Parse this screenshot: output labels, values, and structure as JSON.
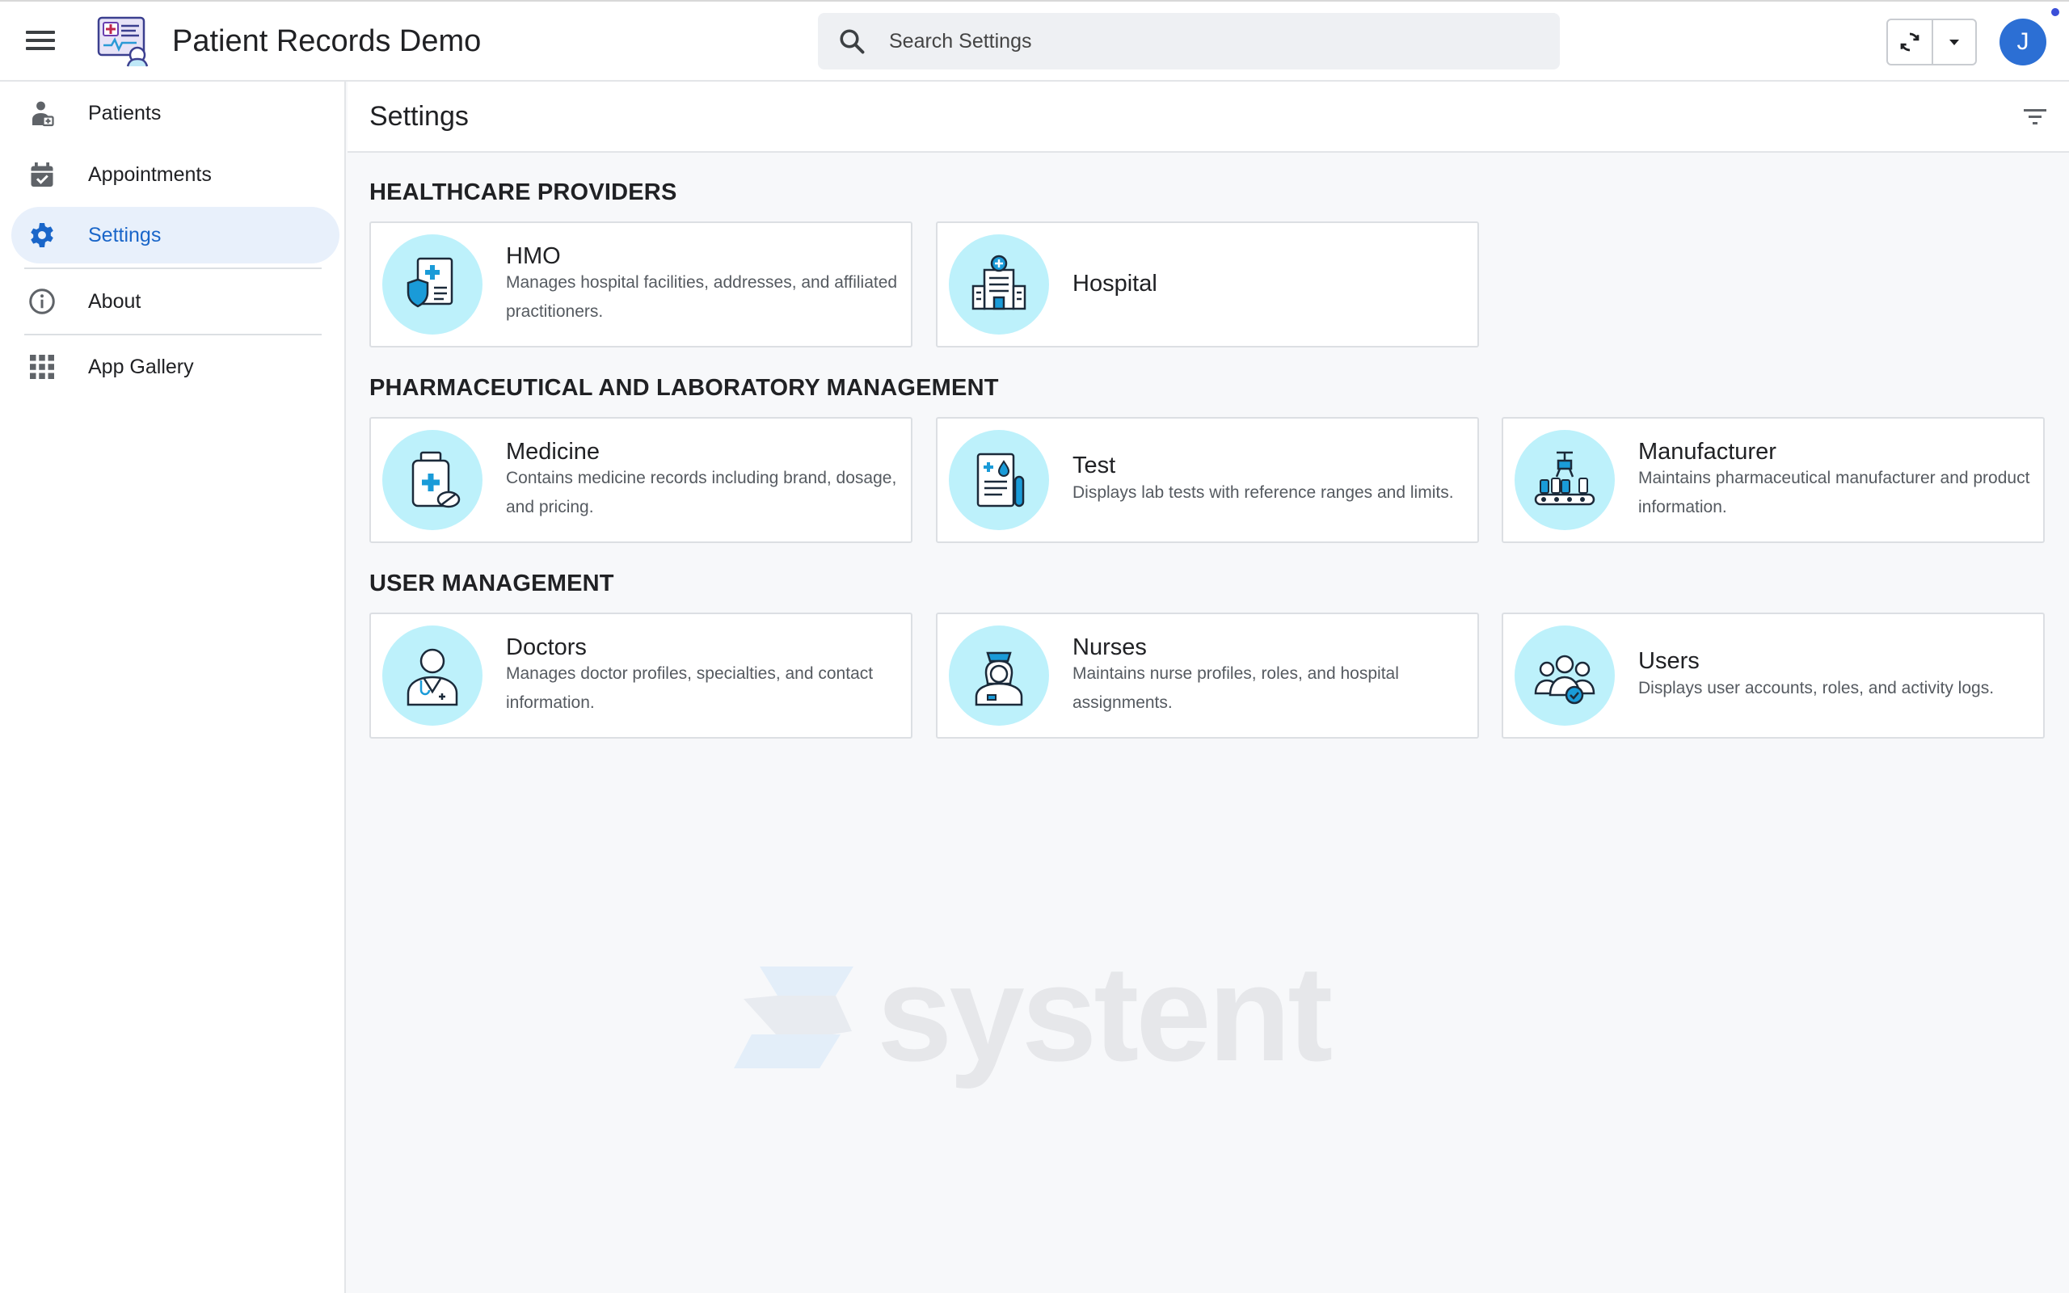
{
  "header": {
    "app_title": "Patient Records Demo",
    "search_placeholder": "Search Settings",
    "avatar_initial": "J"
  },
  "sidebar": {
    "items": [
      {
        "label": "Patients",
        "icon": "patient-icon"
      },
      {
        "label": "Appointments",
        "icon": "calendar-check-icon"
      },
      {
        "label": "Settings",
        "icon": "gear-icon",
        "active": true
      },
      {
        "label": "About",
        "icon": "info-icon"
      },
      {
        "label": "App Gallery",
        "icon": "grid-icon"
      }
    ]
  },
  "main": {
    "page_title": "Settings",
    "sections": [
      {
        "title": "HEALTHCARE PROVIDERS",
        "cards": [
          {
            "title": "HMO",
            "description": "Manages hospital facilities, addresses, and affiliated practitioners.",
            "icon": "hmo-icon"
          },
          {
            "title": "Hospital",
            "description": "",
            "icon": "hospital-icon"
          }
        ]
      },
      {
        "title": "PHARMACEUTICAL AND LABORATORY MANAGEMENT",
        "cards": [
          {
            "title": "Medicine",
            "description": "Contains medicine records including brand, dosage, and pricing.",
            "icon": "medicine-icon"
          },
          {
            "title": "Test",
            "description": "Displays lab tests with reference ranges and limits.",
            "icon": "lab-test-icon"
          },
          {
            "title": "Manufacturer",
            "description": "Maintains pharmaceutical manufacturer and product information.",
            "icon": "manufacturer-icon"
          }
        ]
      },
      {
        "title": "USER MANAGEMENT",
        "cards": [
          {
            "title": "Doctors",
            "description": "Manages doctor profiles, specialties, and contact information.",
            "icon": "doctor-icon"
          },
          {
            "title": "Nurses",
            "description": "Maintains nurse profiles, roles, and hospital assignments.",
            "icon": "nurse-icon"
          },
          {
            "title": "Users",
            "description": "Displays user accounts, roles, and activity logs.",
            "icon": "users-icon"
          }
        ]
      }
    ]
  },
  "watermark": {
    "text": "systent"
  },
  "colors": {
    "accent": "#1a66c9",
    "active_bg": "#e8f0fb",
    "icon_badge": "#bdf1fb",
    "avatar": "#2c6fd4"
  }
}
